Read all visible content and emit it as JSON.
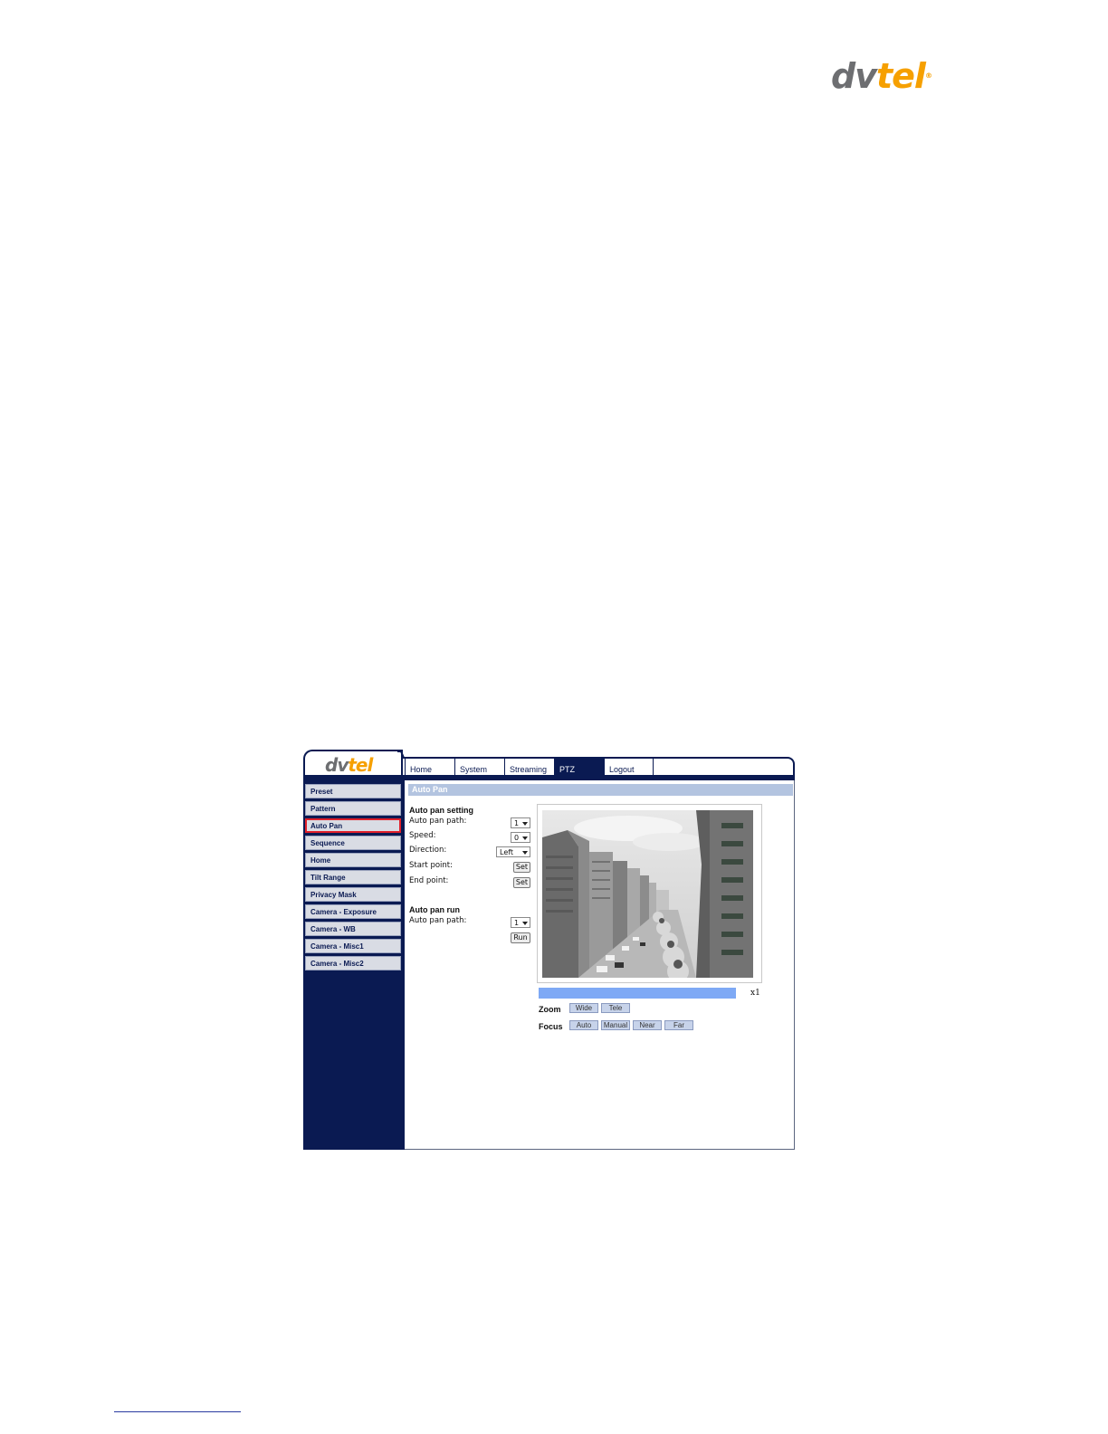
{
  "page_logo": {
    "dv": "dv",
    "tel": "tel",
    "reg": "®"
  },
  "app": {
    "logo": {
      "dv": "dv",
      "tel": "tel"
    },
    "tabs": [
      {
        "label": "Home"
      },
      {
        "label": "System"
      },
      {
        "label": "Streaming"
      },
      {
        "label": "PTZ",
        "active": true
      },
      {
        "label": "Logout"
      }
    ],
    "sidebar": [
      {
        "label": "Preset"
      },
      {
        "label": "Pattern"
      },
      {
        "label": "Auto Pan",
        "selected": true
      },
      {
        "label": "Sequence"
      },
      {
        "label": "Home"
      },
      {
        "label": "Tilt Range"
      },
      {
        "label": "Privacy Mask"
      },
      {
        "label": "Camera - Exposure"
      },
      {
        "label": "Camera - WB"
      },
      {
        "label": "Camera - Misc1"
      },
      {
        "label": "Camera - Misc2"
      }
    ],
    "content_title": "Auto Pan",
    "setting": {
      "heading": "Auto pan setting",
      "path_label": "Auto pan path:",
      "path_value": "1",
      "speed_label": "Speed:",
      "speed_value": "0",
      "direction_label": "Direction:",
      "direction_value": "Left",
      "start_label": "Start point:",
      "end_label": "End point:",
      "set_label": "Set"
    },
    "run": {
      "heading": "Auto pan run",
      "path_label": "Auto pan path:",
      "path_value": "1",
      "run_label": "Run"
    },
    "zoom": {
      "label": "Zoom",
      "value": "x1",
      "wide": "Wide",
      "tele": "Tele"
    },
    "focus": {
      "label": "Focus",
      "auto": "Auto",
      "manual": "Manual",
      "near": "Near",
      "far": "Far"
    }
  }
}
